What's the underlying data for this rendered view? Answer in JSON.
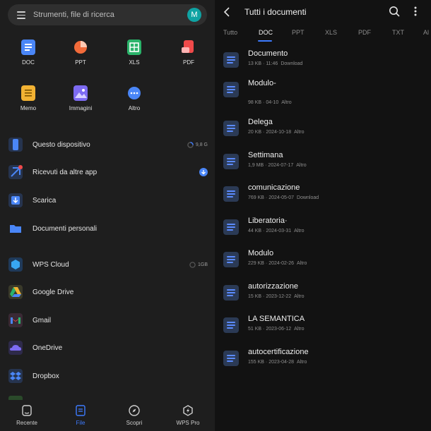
{
  "search": {
    "placeholder": "Strumenti, file di ricerca",
    "avatar": "M"
  },
  "grid": [
    {
      "label": "DOC",
      "icon": "doc-icon",
      "color": "#4a86f7"
    },
    {
      "label": "PPT",
      "icon": "ppt-icon",
      "color": "#f26b3a"
    },
    {
      "label": "XLS",
      "icon": "xls-icon",
      "color": "#2bb36a"
    },
    {
      "label": "PDF",
      "icon": "pdf-icon",
      "color": "#f04a4a"
    },
    {
      "label": "Memo",
      "icon": "memo-icon",
      "color": "#f2b233"
    },
    {
      "label": "Immagini",
      "icon": "images-icon",
      "color": "#7d6bf2"
    },
    {
      "label": "Altro",
      "icon": "more-icon",
      "color": "#4a86f7"
    }
  ],
  "locations": [
    {
      "label": "Questo dispositivo",
      "meta": "9,8 G",
      "icon": "phone-icon"
    },
    {
      "label": "Ricevuti da altre app",
      "meta": "",
      "icon": "received-icon"
    },
    {
      "label": "Scarica",
      "meta": "",
      "icon": "download-icon"
    },
    {
      "label": "Documenti personali",
      "meta": "",
      "icon": "folder-icon"
    }
  ],
  "cloud": [
    {
      "label": "WPS Cloud",
      "meta": "1GB",
      "icon": "wps-cloud-icon"
    },
    {
      "label": "Google Drive",
      "meta": "",
      "icon": "google-drive-icon"
    },
    {
      "label": "Gmail",
      "meta": "",
      "icon": "gmail-icon"
    },
    {
      "label": "OneDrive",
      "meta": "",
      "icon": "onedrive-icon"
    },
    {
      "label": "Dropbox",
      "meta": "",
      "icon": "dropbox-icon"
    }
  ],
  "bottom_nav": [
    {
      "label": "Recente",
      "icon": "recent-icon",
      "active": false
    },
    {
      "label": "File",
      "icon": "file-icon",
      "active": true
    },
    {
      "label": "Scopri",
      "icon": "compass-icon",
      "active": false
    },
    {
      "label": "WPS Pro",
      "icon": "wps-pro-icon",
      "active": false
    }
  ],
  "right": {
    "title": "Tutti i documenti",
    "tabs": [
      "Tutto",
      "DOC",
      "PPT",
      "XLS",
      "PDF",
      "TXT",
      "Al"
    ],
    "active_tab": "DOC",
    "documents": [
      {
        "name": "Documento",
        "size": "13 KB",
        "date": "11:46",
        "source": "Download"
      },
      {
        "name": "Modulo-",
        "size": "98 KB",
        "date": "04-10",
        "source": "Altro"
      },
      {
        "name": "Delega",
        "size": "20 KB",
        "date": "2024-10-18",
        "source": "Altro"
      },
      {
        "name": "Settimana",
        "size": "1,9 MB",
        "date": "2024-07-17",
        "source": "Altro"
      },
      {
        "name": "comunicazione",
        "size": "769 KB",
        "date": "2024-05-07",
        "source": "Download"
      },
      {
        "name": "Liberatoria·",
        "size": "44 KB",
        "date": "2024-03-31",
        "source": "Altro"
      },
      {
        "name": "Modulo",
        "size": "229 KB",
        "date": "2024-02-26",
        "source": "Altro"
      },
      {
        "name": "autorizzazione",
        "size": "15 KB",
        "date": "2023-12-22",
        "source": "Altro"
      },
      {
        "name": "LA SEMANTICA",
        "size": "51 KB",
        "date": "2023-06-12",
        "source": "Altro"
      },
      {
        "name": "autocertificazione",
        "size": "155 KB",
        "date": "2023-04-28",
        "source": "Altro"
      }
    ]
  },
  "colors": {
    "accent": "#3d7bff",
    "bg_left": "#1e1e1e",
    "bg_right": "#121212"
  }
}
